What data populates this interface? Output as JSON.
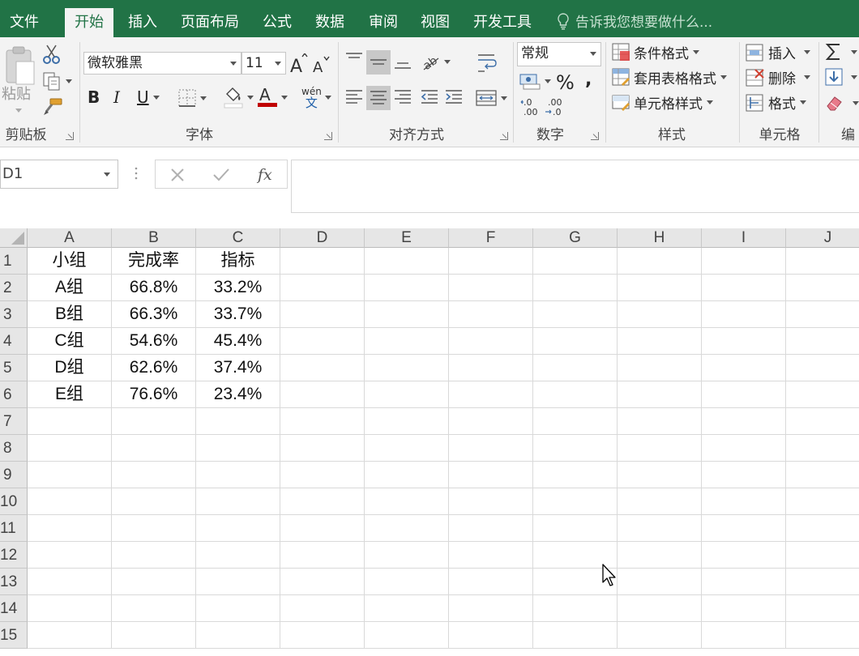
{
  "tabs": [
    {
      "label": "文件",
      "active": false
    },
    {
      "label": "开始",
      "active": true
    },
    {
      "label": "插入",
      "active": false
    },
    {
      "label": "页面布局",
      "active": false
    },
    {
      "label": "公式",
      "active": false
    },
    {
      "label": "数据",
      "active": false
    },
    {
      "label": "审阅",
      "active": false
    },
    {
      "label": "视图",
      "active": false
    },
    {
      "label": "开发工具",
      "active": false
    }
  ],
  "tell_me": "告诉我您想要做什么...",
  "ribbon": {
    "clipboard": {
      "label": "剪贴板",
      "paste_label": "粘贴"
    },
    "font": {
      "label": "字体",
      "font_name": "微软雅黑",
      "font_size": "11",
      "phonetic_top": "wén",
      "phonetic_bottom": "文"
    },
    "alignment": {
      "label": "对齐方式"
    },
    "number": {
      "label": "数字",
      "format": "常规"
    },
    "styles": {
      "label": "样式",
      "conditional_formatting": "条件格式",
      "format_as_table": "套用表格格式",
      "cell_styles": "单元格样式"
    },
    "cells": {
      "label": "单元格",
      "insert": "插入",
      "delete": "删除",
      "format": "格式"
    },
    "editing": {
      "label": "编"
    }
  },
  "formula_bar": {
    "name_box": "D1",
    "formula": ""
  },
  "sheet": {
    "columns": [
      "A",
      "B",
      "C",
      "D",
      "E",
      "F",
      "G",
      "H",
      "I",
      "J"
    ],
    "rows": [
      [
        "小组",
        "完成率",
        "指标",
        "",
        "",
        "",
        "",
        "",
        "",
        ""
      ],
      [
        "A组",
        "66.8%",
        "33.2%",
        "",
        "",
        "",
        "",
        "",
        "",
        ""
      ],
      [
        "B组",
        "66.3%",
        "33.7%",
        "",
        "",
        "",
        "",
        "",
        "",
        ""
      ],
      [
        "C组",
        "54.6%",
        "45.4%",
        "",
        "",
        "",
        "",
        "",
        "",
        ""
      ],
      [
        "D组",
        "62.6%",
        "37.4%",
        "",
        "",
        "",
        "",
        "",
        "",
        ""
      ],
      [
        "E组",
        "76.6%",
        "23.4%",
        "",
        "",
        "",
        "",
        "",
        "",
        ""
      ],
      [
        "",
        "",
        "",
        "",
        "",
        "",
        "",
        "",
        "",
        ""
      ],
      [
        "",
        "",
        "",
        "",
        "",
        "",
        "",
        "",
        "",
        ""
      ],
      [
        "",
        "",
        "",
        "",
        "",
        "",
        "",
        "",
        "",
        ""
      ],
      [
        "",
        "",
        "",
        "",
        "",
        "",
        "",
        "",
        "",
        ""
      ],
      [
        "",
        "",
        "",
        "",
        "",
        "",
        "",
        "",
        "",
        ""
      ],
      [
        "",
        "",
        "",
        "",
        "",
        "",
        "",
        "",
        "",
        ""
      ],
      [
        "",
        "",
        "",
        "",
        "",
        "",
        "",
        "",
        "",
        ""
      ],
      [
        "",
        "",
        "",
        "",
        "",
        "",
        "",
        "",
        "",
        ""
      ],
      [
        "",
        "",
        "",
        "",
        "",
        "",
        "",
        "",
        "",
        ""
      ]
    ],
    "row_numbers": [
      "1",
      "2",
      "3",
      "4",
      "5",
      "6",
      "7",
      "8",
      "9",
      "10",
      "11",
      "12",
      "13",
      "14",
      "15"
    ]
  },
  "colors": {
    "brand": "#217346",
    "font_color_bar": "#c00000"
  }
}
